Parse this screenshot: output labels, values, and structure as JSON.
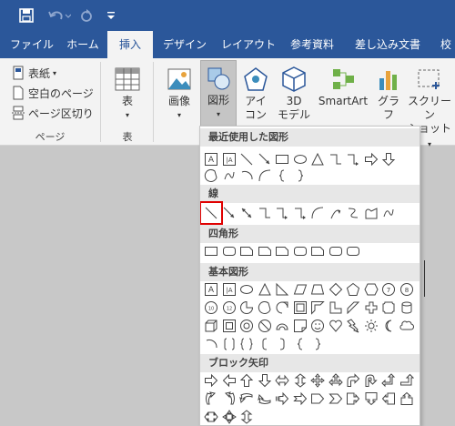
{
  "qat": {
    "save_icon": "save-icon",
    "undo_icon": "undo-icon",
    "redo_icon": "redo-icon",
    "customize_icon": "customize-icon"
  },
  "tabs": [
    {
      "label": "ファイル"
    },
    {
      "label": "ホーム"
    },
    {
      "label": "挿入"
    },
    {
      "label": "デザイン"
    },
    {
      "label": "レイアウト"
    },
    {
      "label": "参考資料"
    },
    {
      "label": "差し込み文書"
    },
    {
      "label": "校"
    }
  ],
  "ribbon": {
    "pages_group": {
      "cover": "表紙",
      "blank": "空白のページ",
      "page_break": "ページ区切り",
      "label": "ページ"
    },
    "table_group": {
      "button": "表",
      "label": "表"
    },
    "illustrations": {
      "picture": "画像",
      "shapes": "図形",
      "icons_line1": "アイ",
      "icons_line2": "コン",
      "model_line1": "3D",
      "model_line2": "モデル",
      "smartart": "SmartArt",
      "chart": "グラフ",
      "screenshot_line1": "スクリーン",
      "screenshot_line2": "ショット"
    }
  },
  "shapes_menu": {
    "recent_header": "最近使用した図形",
    "lines_header": "線",
    "rect_header": "四角形",
    "basic_header": "基本図形",
    "arrows_header": "ブロック矢印"
  }
}
